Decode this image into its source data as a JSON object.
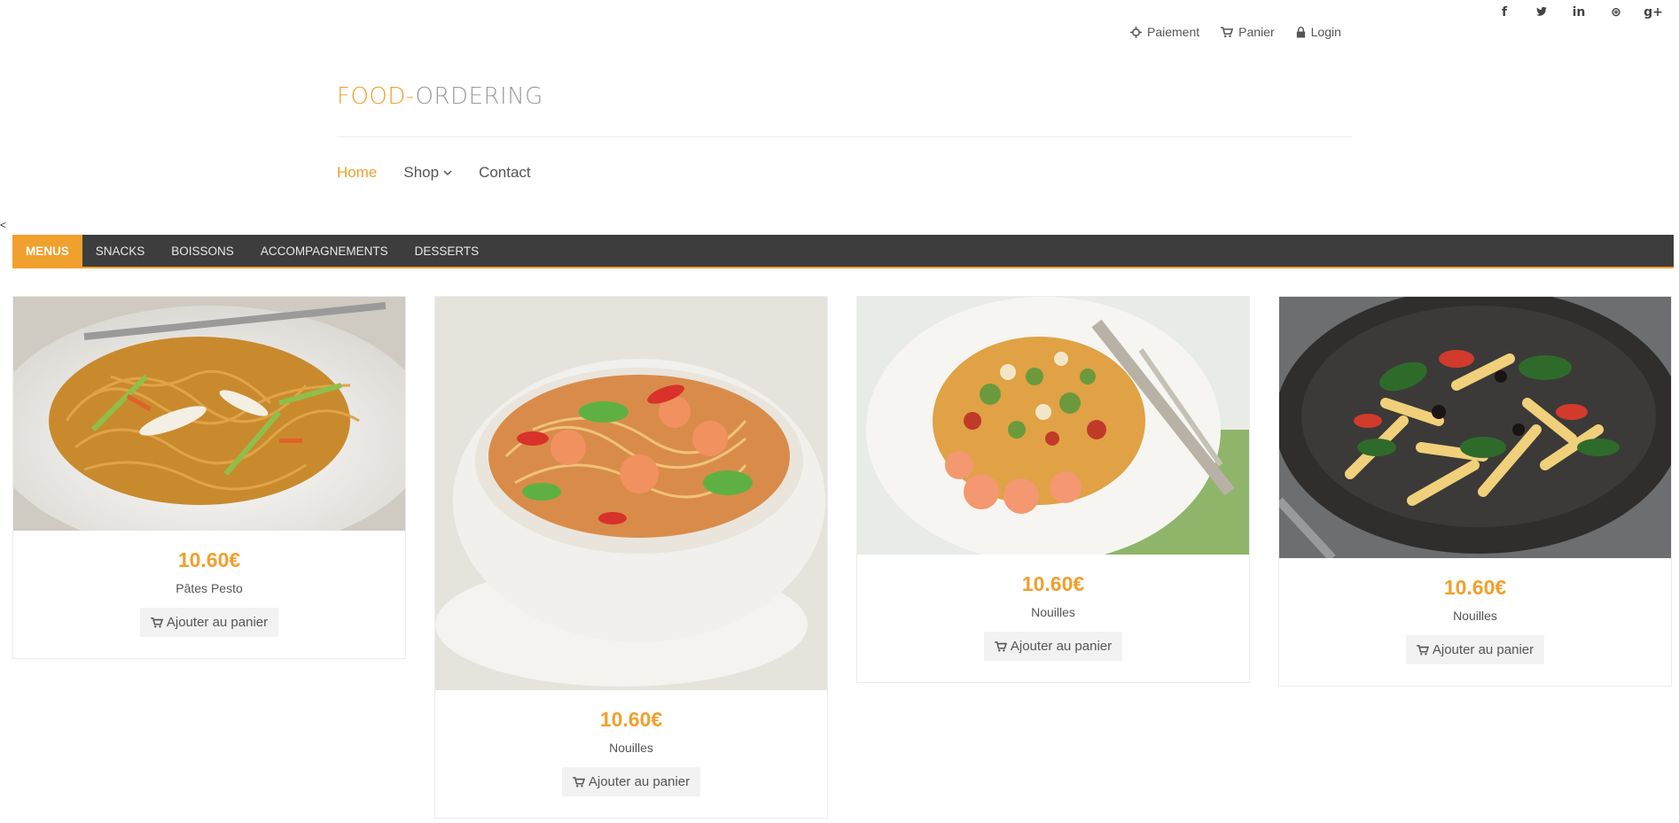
{
  "social": {
    "facebook": "f",
    "twitter": "t",
    "linkedin": "in",
    "dribbble": "⊛",
    "googleplus": "g+"
  },
  "toplinks": {
    "payment": "Paiement",
    "cart": "Panier",
    "login": "Login"
  },
  "logo": {
    "part1": "FOOD-",
    "part2": "ORDERING"
  },
  "mainnav": {
    "home": "Home",
    "shop": "Shop",
    "contact": "Contact"
  },
  "stray_mark": "<",
  "categories": {
    "menus": "MENUS",
    "snacks": "SNACKS",
    "boissons": "BOISSONS",
    "accompagnements": "ACCOMPAGNEMENTS",
    "desserts": "DESSERTS"
  },
  "products": [
    {
      "price": "10.60€",
      "name": "Pâtes Pesto",
      "button": "Ajouter au panier"
    },
    {
      "price": "10.60€",
      "name": "Nouilles",
      "button": "Ajouter au panier"
    },
    {
      "price": "10.60€",
      "name": "Nouilles",
      "button": "Ajouter au panier"
    },
    {
      "price": "10.60€",
      "name": "Nouilles",
      "button": "Ajouter au panier"
    }
  ],
  "colors": {
    "accent": "#f0a02c",
    "catbar": "#3d3d3d"
  }
}
